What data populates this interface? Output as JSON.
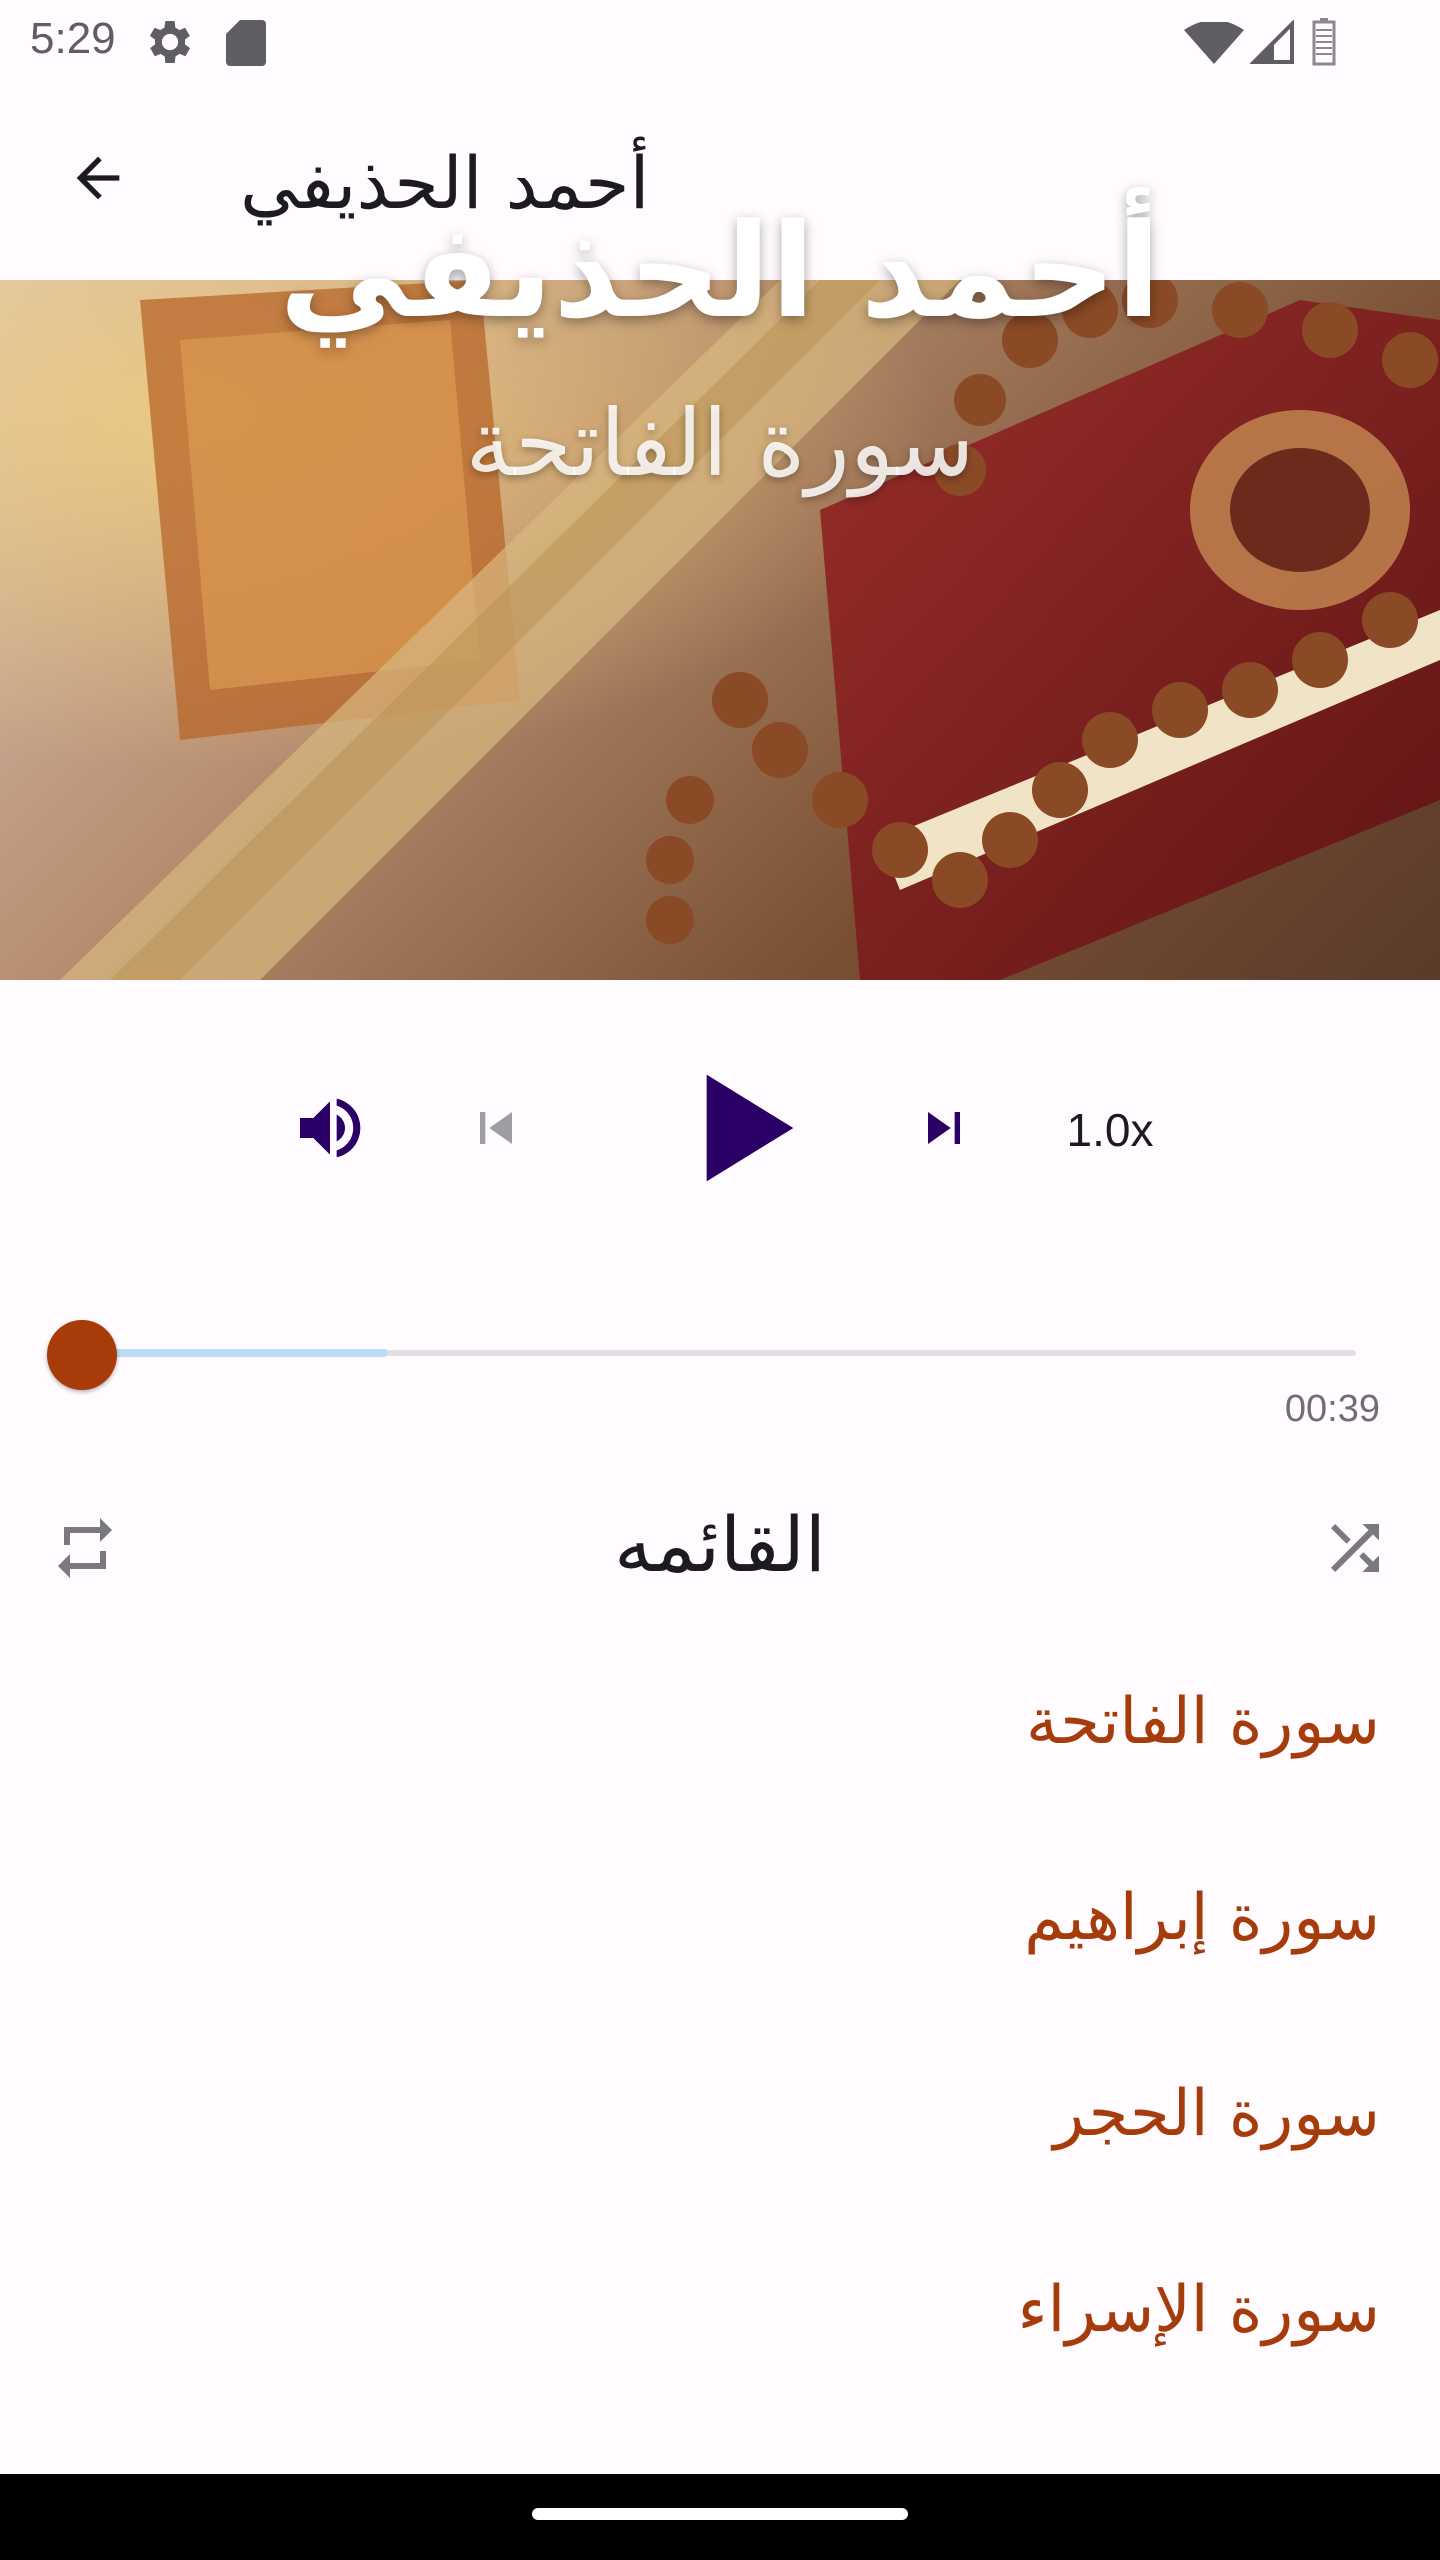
{
  "status_bar": {
    "time": "5:29",
    "icons": [
      "gear-icon",
      "sd-card-icon",
      "wifi-icon",
      "signal-icon",
      "battery-icon"
    ]
  },
  "app_bar": {
    "title": "أحمد الحذيفي",
    "back_icon": "arrow-back-icon"
  },
  "banner": {
    "reciter": "أحمد الحذيفي",
    "surah": "سورة الفاتحة"
  },
  "player": {
    "speed": "1.0x",
    "elapsed": "00:39",
    "progress": 0.0,
    "buffered": 0.24,
    "colors": {
      "primary": "#2a0066",
      "accent": "#a73c0a",
      "buffer": "#bcdcf7"
    }
  },
  "playlist": {
    "title": "القائمه",
    "tracks": [
      {
        "label": "سورة الفاتحة"
      },
      {
        "label": "سورة إبراهيم"
      },
      {
        "label": "سورة الحجر"
      },
      {
        "label": "سورة الإسراء"
      }
    ]
  }
}
